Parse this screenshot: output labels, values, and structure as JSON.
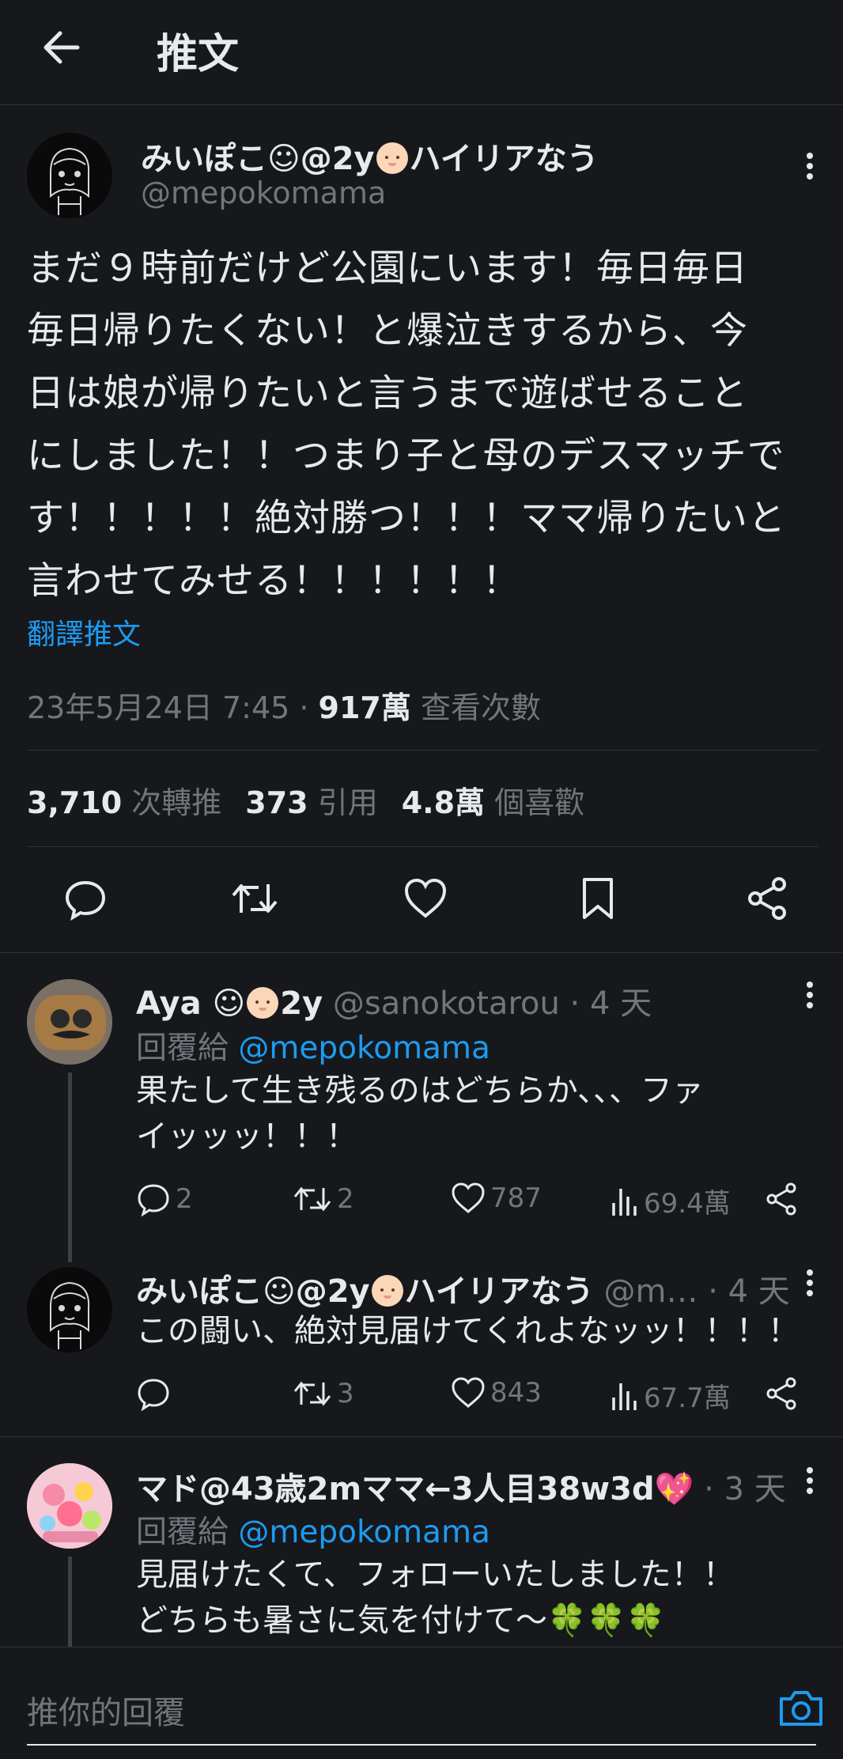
{
  "header": {
    "title": "推文"
  },
  "main_tweet": {
    "author_name_prefix": "みいぽこ☺@2y",
    "author_name_suffix": "ハイリアなう",
    "handle": "@mepokomama",
    "text": "まだ９時前だけど公園にいます！毎日毎日\n毎日帰りたくない！と爆泣きするから、今\n日は娘が帰りたいと言うまで遊ばせること\nにしました！！つまり子と母のデスマッチで\nす！！！！！絶対勝つ！！！ママ帰りたいと\n言わせてみせる！！！！！！",
    "translate_label": "翻譯推文",
    "timestamp": "23年5月24日 7:45 · ",
    "views_count": "917萬",
    "views_label": " 查看次數",
    "stats": {
      "retweets": "3,710",
      "retweets_label": " 次轉推",
      "quotes": "373",
      "quotes_label": " 引用",
      "likes": "4.8萬",
      "likes_label": " 個喜歡"
    }
  },
  "replies": [
    {
      "name": "Aya ☺",
      "name_suffix": "2y",
      "handle": " @sanokotarou",
      "time": " · 4 天",
      "reply_to_label": "回覆給 ",
      "reply_to_handle": "@mepokomama",
      "text": "果たして生き残るのはどちらか、、、ファ\nイッッッ！！！",
      "counts": {
        "replies": "2",
        "retweets": "2",
        "likes": "787",
        "views": "69.4萬"
      }
    },
    {
      "name": "みいぽこ☺@2y",
      "name_suffix": "ハイリアなう",
      "handle": " @m…",
      "time": " · 4 天",
      "text": "この闘い、絶対見届けてくれよなッッ！！！！",
      "counts": {
        "replies": "",
        "retweets": "3",
        "likes": "843",
        "views": "67.7萬"
      }
    },
    {
      "name": "マド@43歳2mママ←3人目38w3d💖",
      "handle": "",
      "time": " · 3 天",
      "reply_to_label": "回覆給 ",
      "reply_to_handle": "@mepokomama",
      "text": "見届けたくて、フォローいたしました！！\nどちらも暑さに気を付けて〜🍀🍀🍀"
    }
  ],
  "compose": {
    "placeholder": "推你的回覆"
  },
  "colors": {
    "background": "#16181c",
    "accent": "#1d9bf0",
    "muted": "#71767b",
    "text": "#e7e9ea"
  }
}
